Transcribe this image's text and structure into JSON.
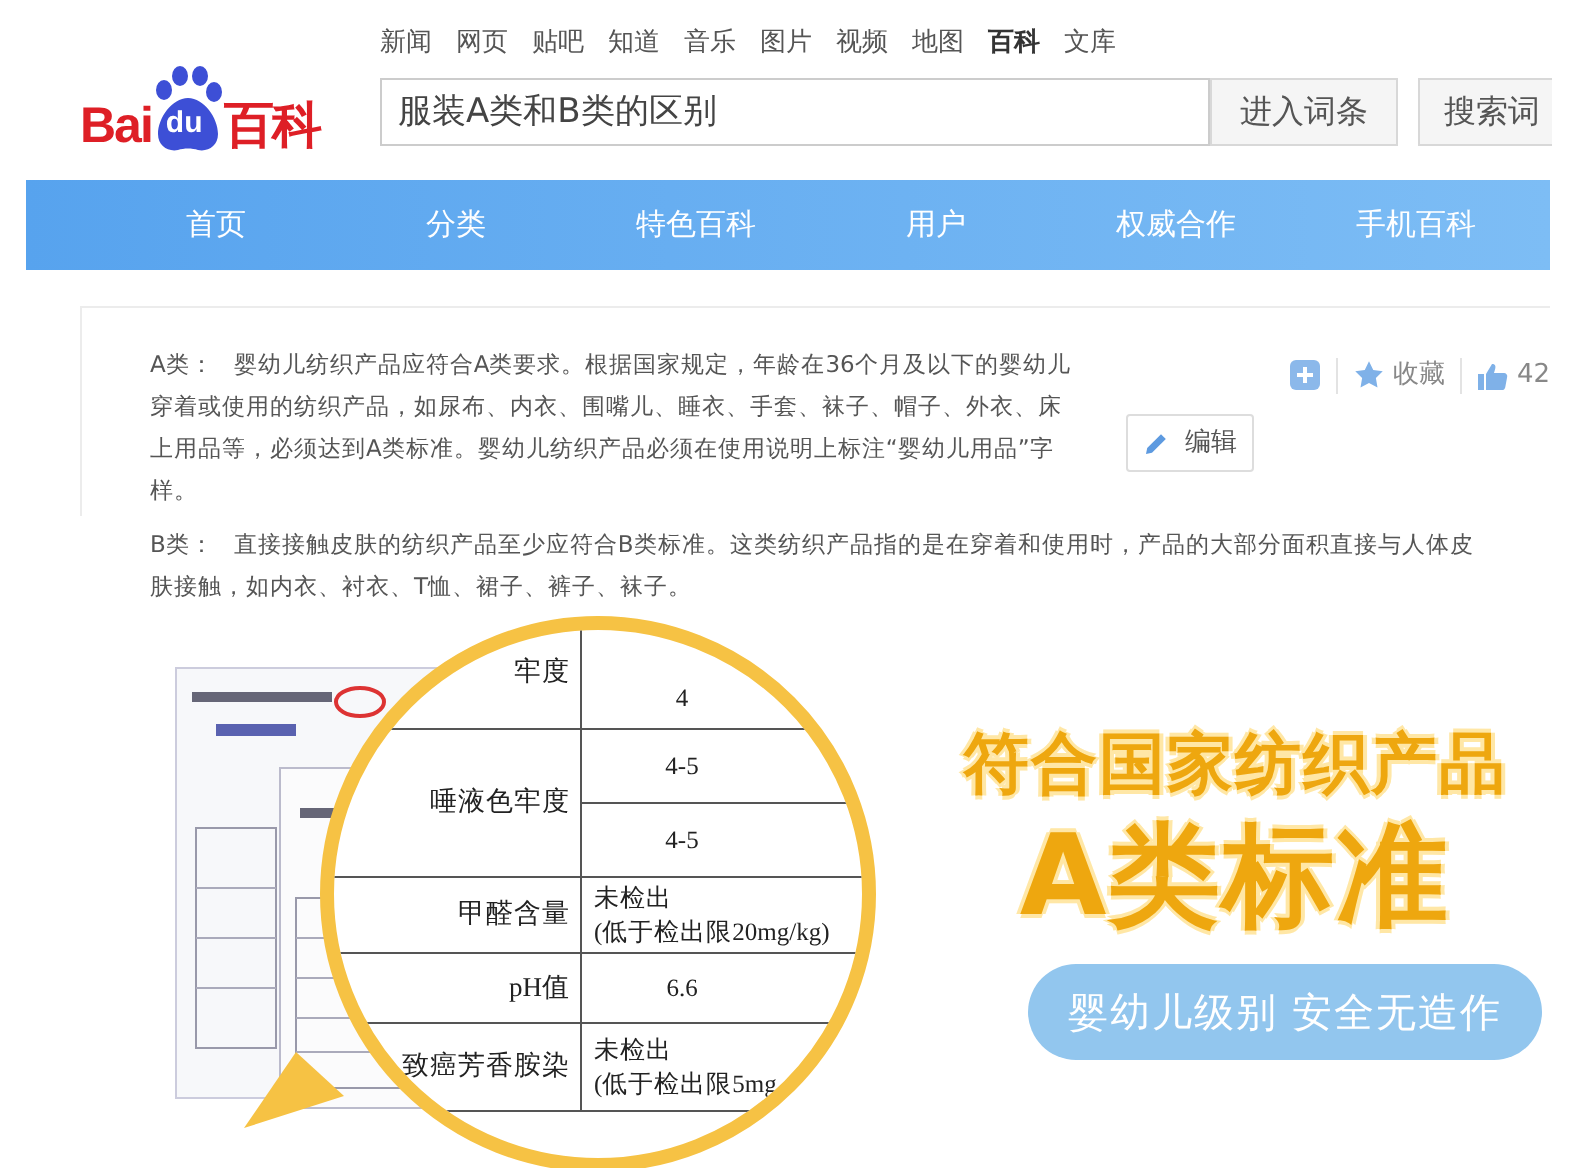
{
  "header": {
    "logo": {
      "left": "Bai",
      "paw": "du",
      "right": "百科"
    },
    "top_links": [
      {
        "label": "新闻",
        "selected": false
      },
      {
        "label": "网页",
        "selected": false
      },
      {
        "label": "贴吧",
        "selected": false
      },
      {
        "label": "知道",
        "selected": false
      },
      {
        "label": "音乐",
        "selected": false
      },
      {
        "label": "图片",
        "selected": false
      },
      {
        "label": "视频",
        "selected": false
      },
      {
        "label": "地图",
        "selected": false
      },
      {
        "label": "百科",
        "selected": true
      },
      {
        "label": "文库",
        "selected": false
      }
    ],
    "search": {
      "value": "服装A类和B类的区别"
    },
    "buttons": [
      "进入词条",
      "搜索词"
    ]
  },
  "nav": {
    "items": [
      "首页",
      "分类",
      "特色百科",
      "用户",
      "权威合作",
      "手机百科"
    ]
  },
  "entry": {
    "paragraphs": [
      {
        "label": "A类：",
        "text": "婴幼儿纺织产品应符合A类要求。根据国家规定，年龄在36个月及以下的婴幼儿穿着或使用的纺织产品，如尿布、内衣、围嘴儿、睡衣、手套、袜子、帽子、外衣、床上用品等，必须达到A类标准。婴幼儿纺织产品必须在使用说明上标注“婴幼儿用品”字样。"
      },
      {
        "label": "B类：",
        "text": "直接接触皮肤的纺织产品至少应符合B类标准。这类纺织产品指的是在穿着和使用时，产品的大部分面积直接与人体皮肤接触，如内衣、衬衣、T恤、裙子、裤子、袜子。"
      }
    ],
    "collect": "收藏",
    "likes": "42",
    "edit": "编辑"
  },
  "promo": {
    "report_rows": [
      {
        "item": "牢度",
        "values": [
          "4"
        ]
      },
      {
        "item": "唾液色牢度",
        "values": [
          "4-5",
          "4-5"
        ]
      },
      {
        "item": "甲醛含量",
        "values": [
          "未检出\n(低于检出限20mg/kg)"
        ]
      },
      {
        "item": "pH值",
        "values": [
          "6.6"
        ]
      },
      {
        "item": "致癌芳香胺染",
        "values": [
          "未检出\n(低于检出限5mg"
        ]
      }
    ],
    "headline": "符合国家纺织产品",
    "subheadline": "A类标准",
    "pill": "婴幼儿级别 安全无造作"
  }
}
